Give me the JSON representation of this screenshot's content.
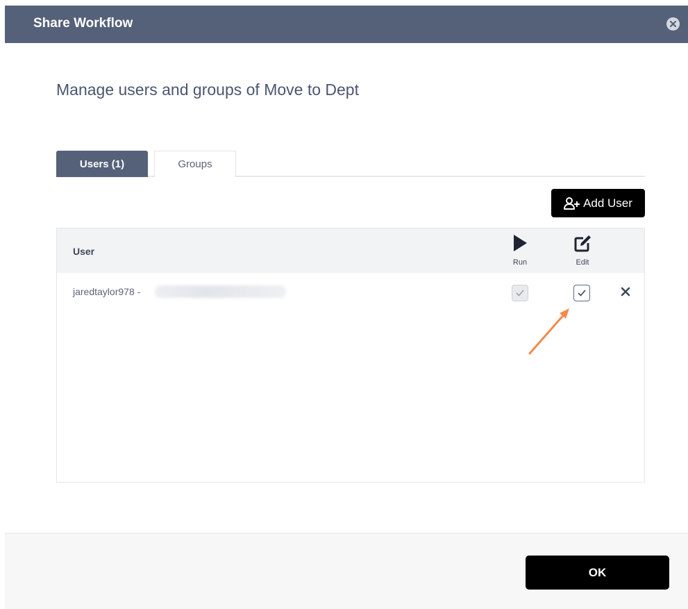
{
  "dialog": {
    "title": "Share Workflow",
    "heading": "Manage users and groups of Move to Dept"
  },
  "tabs": [
    {
      "label": "Users (1)",
      "active": true
    },
    {
      "label": "Groups",
      "active": false
    }
  ],
  "toolbar": {
    "add_user_label": "Add User"
  },
  "table": {
    "headers": {
      "user": "User",
      "run": "Run",
      "edit": "Edit"
    },
    "rows": [
      {
        "username": "jaredtaylor978 -",
        "run_checked": true,
        "run_disabled": true,
        "edit_checked": true
      }
    ]
  },
  "footer": {
    "ok_label": "OK"
  },
  "colors": {
    "titlebar": "#556179",
    "active_tab": "#556179",
    "primary_button": "#000000",
    "annotation_arrow": "#f28a4a"
  },
  "icons": {
    "close": "close-circle-icon",
    "add_user": "user-plus-icon",
    "run": "play-icon",
    "edit": "edit-icon",
    "check": "check-icon",
    "remove": "close-x-icon"
  }
}
